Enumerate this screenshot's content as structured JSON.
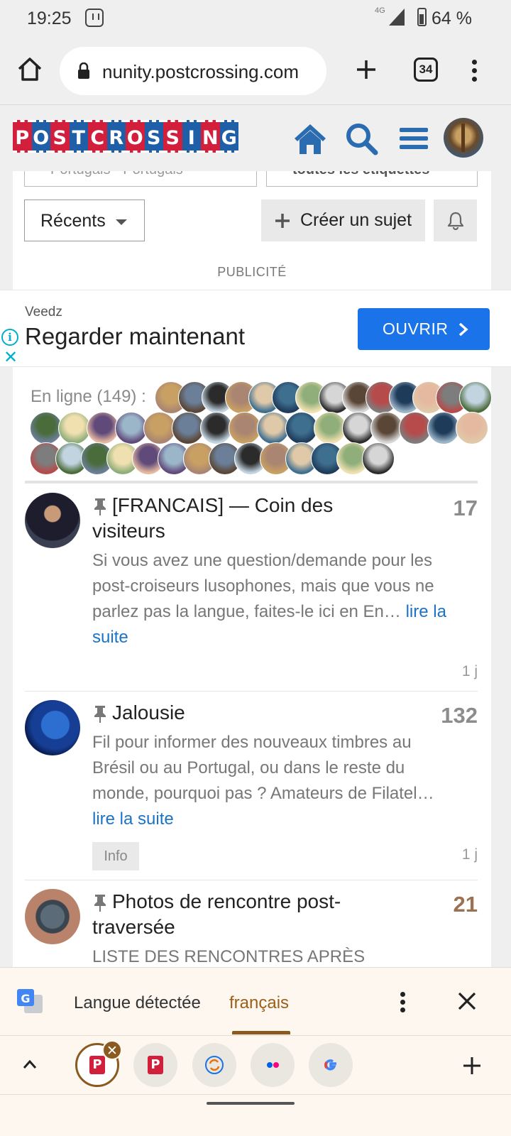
{
  "status_bar": {
    "time": "19:25",
    "network": "4G",
    "battery": "64 %"
  },
  "browser": {
    "url": "nunity.postcrossing.com",
    "tab_count": "34"
  },
  "site": {
    "logo_text": "POSTCROSSING"
  },
  "filters": {
    "category_partial": "Portugais - Portugais",
    "tags_partial": "toutes les étiquettes"
  },
  "controls": {
    "sort_label": "Récents",
    "create_topic_label": "Créer un sujet"
  },
  "ad": {
    "section_label": "PUBLICITÉ",
    "brand": "Veedz",
    "headline": "Regarder maintenant",
    "cta": "OUVRIR"
  },
  "online": {
    "label": "En ligne (149) :"
  },
  "topics": [
    {
      "title": "[FRANCAIS] — Coin des visiteurs",
      "count": "17",
      "excerpt": "Si vous avez une question/demande pour les post-croiseurs lusophones, mais que vous ne parlez pas la langue, faites-le ici en En…",
      "read_more": "lire la suite",
      "time": "1 j"
    },
    {
      "title": "Jalousie",
      "count": "132",
      "excerpt": "Fil pour informer des nouveaux timbres au Brésil ou au Portugal, ou dans le reste du monde, pourquoi pas ? Amateurs de Filatel…",
      "read_more": "lire la suite",
      "tag": "Info",
      "time": "1 j"
    },
    {
      "title": "Photos de rencontre post-traversée",
      "count": "21",
      "excerpt": "LISTE DES RENCONTRES APRÈS"
    }
  ],
  "translate": {
    "detected_label": "Langue détectée",
    "language": "français"
  },
  "colors": {
    "brand_red": "#d21f3c",
    "brand_blue": "#1f5fa8",
    "link": "#1a73c7",
    "cta": "#1a73e8",
    "hot_count": "#9b7251"
  }
}
